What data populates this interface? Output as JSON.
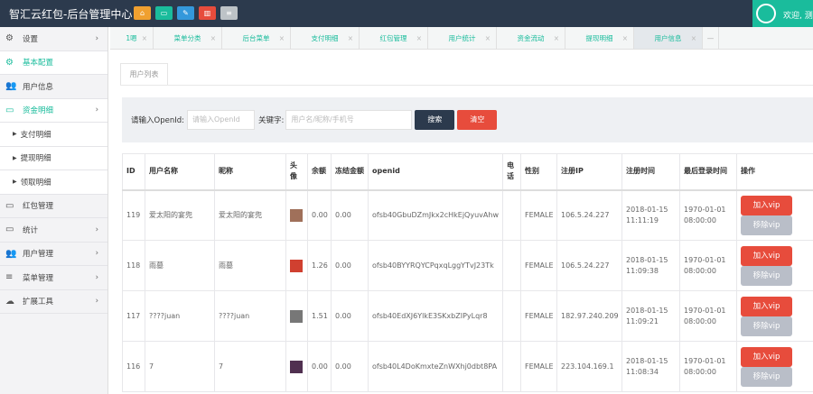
{
  "header": {
    "title": "智汇云红包-后台管理中心",
    "quick_buttons": [
      {
        "icon": "home-icon",
        "color": "#f0a030"
      },
      {
        "icon": "image-icon",
        "color": "#1abc9c"
      },
      {
        "icon": "pencil-icon",
        "color": "#3498db"
      },
      {
        "icon": "trash-icon",
        "color": "#e74c3c"
      },
      {
        "icon": "list-icon",
        "color": "#bdc3c7"
      }
    ],
    "welcome": "欢迎, 测试"
  },
  "sidebar": {
    "items": [
      {
        "label": "设置",
        "icon": "gears-icon",
        "chevron": true
      },
      {
        "label": "基本配置",
        "icon": "gears-icon",
        "active": true
      },
      {
        "label": "用户信息",
        "icon": "users-icon"
      },
      {
        "label": "资金明细",
        "icon": "monitor-icon",
        "chevron": true,
        "active": true
      },
      {
        "label": "支付明细",
        "sub": true
      },
      {
        "label": "提现明细",
        "sub": true
      },
      {
        "label": "领取明细",
        "sub": true
      },
      {
        "label": "红包管理",
        "icon": "monitor-icon"
      },
      {
        "label": "统计",
        "icon": "monitor-icon",
        "chevron": true
      },
      {
        "label": "用户管理",
        "icon": "users-icon",
        "chevron": true
      },
      {
        "label": "菜单管理",
        "icon": "list-icon",
        "chevron": true
      },
      {
        "label": "扩展工具",
        "icon": "cloud-icon",
        "chevron": true
      }
    ]
  },
  "tabs": [
    "1嗯",
    "菜单分类",
    "后台菜单",
    "支付明细",
    "红包管理",
    "用户统计",
    "资金流动",
    "提现明细",
    "用户信息"
  ],
  "page_tab": "用户列表",
  "search": {
    "openid_label": "请输入OpenId:",
    "openid_placeholder": "请输入OpenId",
    "keyword_label": "关键字:",
    "keyword_placeholder": "用户名/昵称/手机号",
    "search_button": "搜索",
    "clear_button": "清空"
  },
  "table": {
    "headers": [
      "ID",
      "用户名称",
      "昵称",
      "头像",
      "余额",
      "冻结金额",
      "openid",
      "电话",
      "性别",
      "注册IP",
      "注册时间",
      "最后登录时间",
      "操作"
    ],
    "rows": [
      {
        "id": "119",
        "name": "爱太阳的宴兜",
        "nick": "爱太阳的宴兜",
        "balance": "0.00",
        "frozen": "0.00",
        "openid": "ofsb40GbuDZmJkx2cHkEjQyuvAhw",
        "phone": "",
        "gender": "FEMALE",
        "ip": "106.5.24.227",
        "reg_date": "2018-01-15",
        "reg_time": "11:11:19",
        "last_date": "1970-01-01",
        "last_time": "08:00:00",
        "avatar_color": "#a0705a"
      },
      {
        "id": "118",
        "name": "雨墓",
        "nick": "雨墓",
        "balance": "1.26",
        "frozen": "0.00",
        "openid": "ofsb40BYYRQYCPqxqLggYTvJ23Tk",
        "phone": "",
        "gender": "FEMALE",
        "ip": "106.5.24.227",
        "reg_date": "2018-01-15",
        "reg_time": "11:09:38",
        "last_date": "1970-01-01",
        "last_time": "08:00:00",
        "avatar_color": "#d04030"
      },
      {
        "id": "117",
        "name": "????juan",
        "nick": "????juan",
        "balance": "1.51",
        "frozen": "0.00",
        "openid": "ofsb40EdXJ6YlkE3SKxbZIPyLqr8",
        "phone": "",
        "gender": "FEMALE",
        "ip": "182.97.240.209",
        "reg_date": "2018-01-15",
        "reg_time": "11:09:21",
        "last_date": "1970-01-01",
        "last_time": "08:00:00",
        "avatar_color": "#777"
      },
      {
        "id": "116",
        "name": "7",
        "nick": "7",
        "balance": "0.00",
        "frozen": "0.00",
        "openid": "ofsb40L4DoKmxteZnWXhj0dbt8PA",
        "phone": "",
        "gender": "FEMALE",
        "ip": "223.104.169.1",
        "reg_date": "2018-01-15",
        "reg_time": "11:08:34",
        "last_date": "1970-01-01",
        "last_time": "08:00:00",
        "avatar_color": "#503050"
      }
    ],
    "add_vip": "加入vip",
    "remove_vip": "移除vip"
  },
  "colors": {
    "header": "#2c3a4d",
    "accent": "#1abc9c",
    "danger": "#e74c3c",
    "dark_button": "#2c3a4d",
    "muted_button": "#b9bec8"
  }
}
